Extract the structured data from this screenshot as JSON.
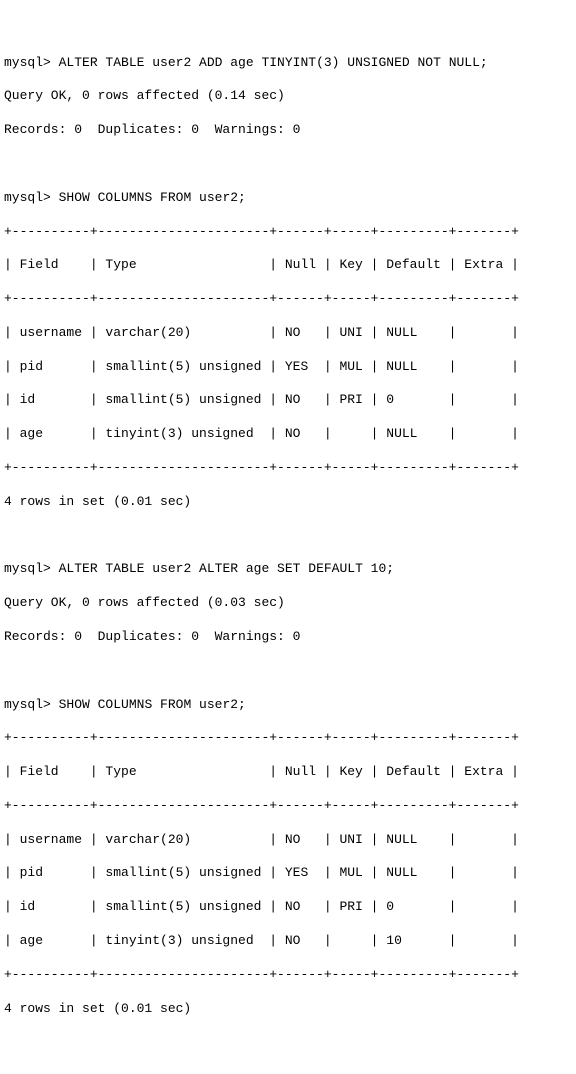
{
  "prompt": "mysql>",
  "commands": {
    "alter1": "ALTER TABLE user2 ADD age TINYINT(3) UNSIGNED NOT NULL;",
    "alter1_result1": "Query OK, 0 rows affected (0.14 sec)",
    "alter1_result2": "Records: 0  Duplicates: 0  Warnings: 0",
    "show1": "SHOW COLUMNS FROM user2;",
    "alter2": "ALTER TABLE user2 ALTER age SET DEFAULT 10;",
    "alter2_result1": "Query OK, 0 rows affected (0.03 sec)",
    "alter2_result2": "Records: 0  Duplicates: 0  Warnings: 0",
    "show2": "SHOW COLUMNS FROM user2;"
  },
  "table1": {
    "border": "+----------+----------------------+------+-----+---------+-------+",
    "header": "| Field    | Type                 | Null | Key | Default | Extra |",
    "rows": [
      "| username | varchar(20)          | NO   | UNI | NULL    |       |",
      "| pid      | smallint(5) unsigned | YES  | MUL | NULL    |       |",
      "| id       | smallint(5) unsigned | NO   | PRI | 0       |       |",
      "| age      | tinyint(3) unsigned  | NO   |     | NULL    |       |"
    ],
    "footer": "4 rows in set (0.01 sec)"
  },
  "table2": {
    "border": "+----------+----------------------+------+-----+---------+-------+",
    "header": "| Field    | Type                 | Null | Key | Default | Extra |",
    "rows": [
      "| username | varchar(20)          | NO   | UNI | NULL    |       |",
      "| pid      | smallint(5) unsigned | YES  | MUL | NULL    |       |",
      "| id       | smallint(5) unsigned | NO   | PRI | 0       |       |",
      "| age      | tinyint(3) unsigned  | NO   |     | 10      |       |"
    ],
    "footer": "4 rows in set (0.01 sec)"
  },
  "chart_data": [
    {
      "type": "table",
      "title": "SHOW COLUMNS FROM user2 (before default change)",
      "columns": [
        "Field",
        "Type",
        "Null",
        "Key",
        "Default",
        "Extra"
      ],
      "rows": [
        [
          "username",
          "varchar(20)",
          "NO",
          "UNI",
          "NULL",
          ""
        ],
        [
          "pid",
          "smallint(5) unsigned",
          "YES",
          "MUL",
          "NULL",
          ""
        ],
        [
          "id",
          "smallint(5) unsigned",
          "NO",
          "PRI",
          "0",
          ""
        ],
        [
          "age",
          "tinyint(3) unsigned",
          "NO",
          "",
          "NULL",
          ""
        ]
      ]
    },
    {
      "type": "table",
      "title": "SHOW COLUMNS FROM user2 (after SET DEFAULT 10)",
      "columns": [
        "Field",
        "Type",
        "Null",
        "Key",
        "Default",
        "Extra"
      ],
      "rows": [
        [
          "username",
          "varchar(20)",
          "NO",
          "UNI",
          "NULL",
          ""
        ],
        [
          "pid",
          "smallint(5) unsigned",
          "YES",
          "MUL",
          "NULL",
          ""
        ],
        [
          "id",
          "smallint(5) unsigned",
          "NO",
          "PRI",
          "0",
          ""
        ],
        [
          "age",
          "tinyint(3) unsigned",
          "NO",
          "",
          "10",
          ""
        ]
      ]
    }
  ]
}
